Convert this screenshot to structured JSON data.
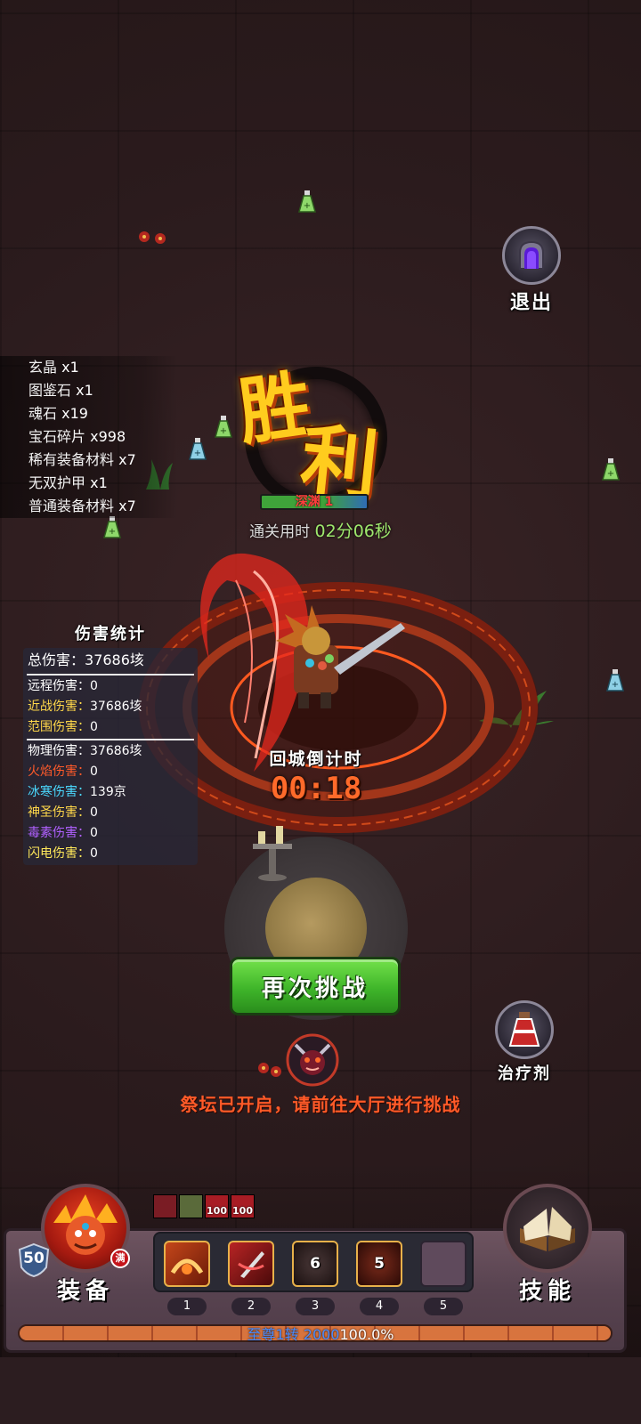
{
  "exit": {
    "label": "退出"
  },
  "loot": [
    {
      "name": "玄晶",
      "count": "x1"
    },
    {
      "name": "图鉴石",
      "count": "x1"
    },
    {
      "name": "魂石",
      "count": "x19"
    },
    {
      "name": "宝石碎片",
      "count": "x998"
    },
    {
      "name": "稀有装备材料",
      "count": "x7"
    },
    {
      "name": "无双护甲",
      "count": "x1"
    },
    {
      "name": "普通装备材料",
      "count": "x7"
    }
  ],
  "victory": {
    "char1": "胜",
    "char2": "利",
    "stage": "深渊 1",
    "clear_label": "通关用时",
    "clear_time": "02分06秒"
  },
  "damage": {
    "title": "伤害统计",
    "total": {
      "label": "总伤害：",
      "value": "37686垓"
    },
    "rows_a": [
      {
        "label": "远程伤害：",
        "value": "0",
        "color": "#ffffff"
      },
      {
        "label": "近战伤害：",
        "value": "37686垓",
        "color": "#ffd84a"
      },
      {
        "label": "范围伤害：",
        "value": "0",
        "color": "#ffd84a"
      }
    ],
    "rows_b": [
      {
        "label": "物理伤害：",
        "value": "37686垓",
        "color": "#ffffff"
      },
      {
        "label": "火焰伤害：",
        "value": "0",
        "color": "#ff5a2a"
      },
      {
        "label": "冰寒伤害：",
        "value": "139京",
        "color": "#4ad9ff"
      },
      {
        "label": "神圣伤害：",
        "value": "0",
        "color": "#ffd84a"
      },
      {
        "label": "毒素伤害：",
        "value": "0",
        "color": "#b060ff"
      },
      {
        "label": "闪电伤害：",
        "value": "0",
        "color": "#ffe85a"
      }
    ]
  },
  "countdown": {
    "label": "回城倒计时",
    "time": "00:18"
  },
  "retry": {
    "label": "再次挑战"
  },
  "heal": {
    "label": "治疗剂"
  },
  "altar_msg": "祭坛已开启，请前往大厅进行挑战",
  "buffs": [
    {
      "count": "",
      "color": "#7a1c24"
    },
    {
      "count": "",
      "color": "#5a6a3a"
    },
    {
      "count": "100",
      "color": "#a81c24"
    },
    {
      "count": "100",
      "color": "#a81c24"
    }
  ],
  "hud": {
    "equip_label": "装备",
    "level": "50",
    "full_badge": "满",
    "skills_label": "技能",
    "slots": [
      {
        "num": "1",
        "count": "",
        "icon": "fire-slash-icon"
      },
      {
        "num": "2",
        "count": "",
        "icon": "blade-strike-icon"
      },
      {
        "num": "3",
        "count": "6",
        "icon": "skull-icon"
      },
      {
        "num": "4",
        "count": "5",
        "icon": "flame-demon-icon"
      },
      {
        "num": "5",
        "count": "",
        "icon": "empty"
      }
    ],
    "xp": {
      "rank": "至尊1转",
      "level": "2000",
      "percent": "100.0%",
      "fill": 1.0
    }
  }
}
